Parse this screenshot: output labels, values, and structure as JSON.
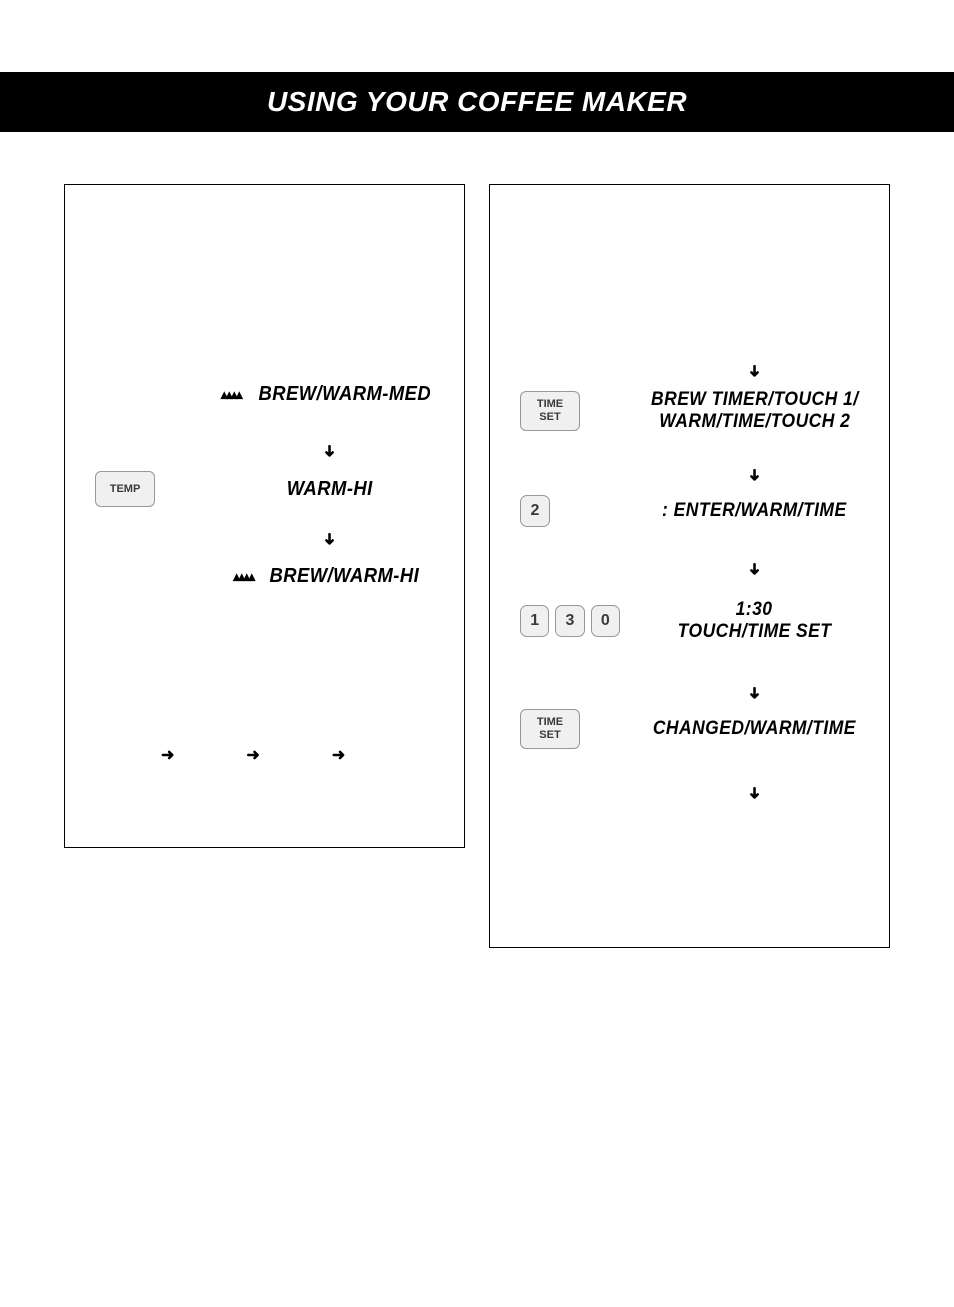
{
  "header": {
    "title": "USING YOUR COFFEE MAKER"
  },
  "left_panel": {
    "rows": [
      {
        "button": "TEMP",
        "lcd": "BREW/WARM-MED",
        "with_steam": true
      },
      {
        "lcd": "WARM-HI"
      },
      {
        "lcd": "BREW/WARM-HI",
        "with_steam": true
      }
    ]
  },
  "right_panel": {
    "rows": [
      {
        "button_multiline": [
          "TIME",
          "SET"
        ],
        "lcd_lines": [
          "BREW TIMER/TOUCH 1/",
          "WARM/TIME/TOUCH 2"
        ]
      },
      {
        "digits": [
          "2"
        ],
        "lcd": ": ENTER/WARM/TIME"
      },
      {
        "digits": [
          "1",
          "3",
          "0"
        ],
        "lcd_lines": [
          "1:30",
          "TOUCH/TIME SET"
        ]
      },
      {
        "button_multiline": [
          "TIME",
          "SET"
        ],
        "lcd": "CHANGED/WARM/TIME"
      }
    ]
  },
  "icons": {
    "steam": "▲▲▲▲",
    "arrow_down": "➜",
    "arrow_right": "➜"
  }
}
